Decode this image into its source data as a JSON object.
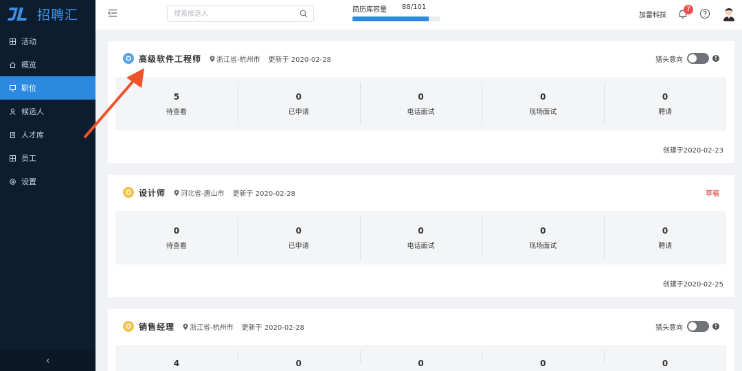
{
  "brand": {
    "name": "招聘汇",
    "color": "#3a8ee6"
  },
  "sidebar": {
    "items": [
      {
        "label": "活动",
        "icon": "grid-icon",
        "active": false
      },
      {
        "label": "概览",
        "icon": "home-icon",
        "active": false
      },
      {
        "label": "职位",
        "icon": "monitor-icon",
        "active": true
      },
      {
        "label": "候选人",
        "icon": "user-icon",
        "active": false
      },
      {
        "label": "人才库",
        "icon": "book-icon",
        "active": false
      },
      {
        "label": "员工",
        "icon": "grid-icon",
        "active": false
      },
      {
        "label": "设置",
        "icon": "settings-icon",
        "active": false
      }
    ],
    "collapse": "‹"
  },
  "header": {
    "search_placeholder": "搜索候选人",
    "capacity_label": "简历库容量",
    "capacity_value": "88/101",
    "capacity_fraction": 0.871,
    "company": "加雷科技",
    "notifications": "7"
  },
  "jobs": [
    {
      "title": "高级软件工程师",
      "icon_color": "blue",
      "location": "浙江省-杭州市",
      "updated": "更新于 2020-02-28",
      "right_type": "toggle",
      "hunter_label": "猎头意向",
      "created": "创建于2020-02-23",
      "stats": [
        {
          "num": "5",
          "label": "待查看"
        },
        {
          "num": "0",
          "label": "已申请"
        },
        {
          "num": "0",
          "label": "电话面试"
        },
        {
          "num": "0",
          "label": "现场面试"
        },
        {
          "num": "0",
          "label": "聘请"
        }
      ]
    },
    {
      "title": "设计师",
      "icon_color": "yellow",
      "location": "河北省-唐山市",
      "updated": "更新于 2020-02-28",
      "right_type": "draft",
      "draft_label": "草稿",
      "created": "创建于2020-02-25",
      "stats": [
        {
          "num": "0",
          "label": "待查看"
        },
        {
          "num": "0",
          "label": "已申请"
        },
        {
          "num": "0",
          "label": "电话面试"
        },
        {
          "num": "0",
          "label": "现场面试"
        },
        {
          "num": "0",
          "label": "聘请"
        }
      ]
    },
    {
      "title": "销售经理",
      "icon_color": "yellow",
      "location": "浙江省-杭州市",
      "updated": "更新于 2020-02-28",
      "right_type": "toggle",
      "hunter_label": "猎头意向",
      "stats": [
        {
          "num": "4"
        },
        {
          "num": "0"
        },
        {
          "num": "0"
        },
        {
          "num": "0"
        },
        {
          "num": "0"
        }
      ]
    }
  ],
  "colors": {
    "sidebar_bg": "#0d1d30",
    "accent": "#2b89e0",
    "draft": "#e02b2b",
    "arrow": "#f0532c"
  }
}
